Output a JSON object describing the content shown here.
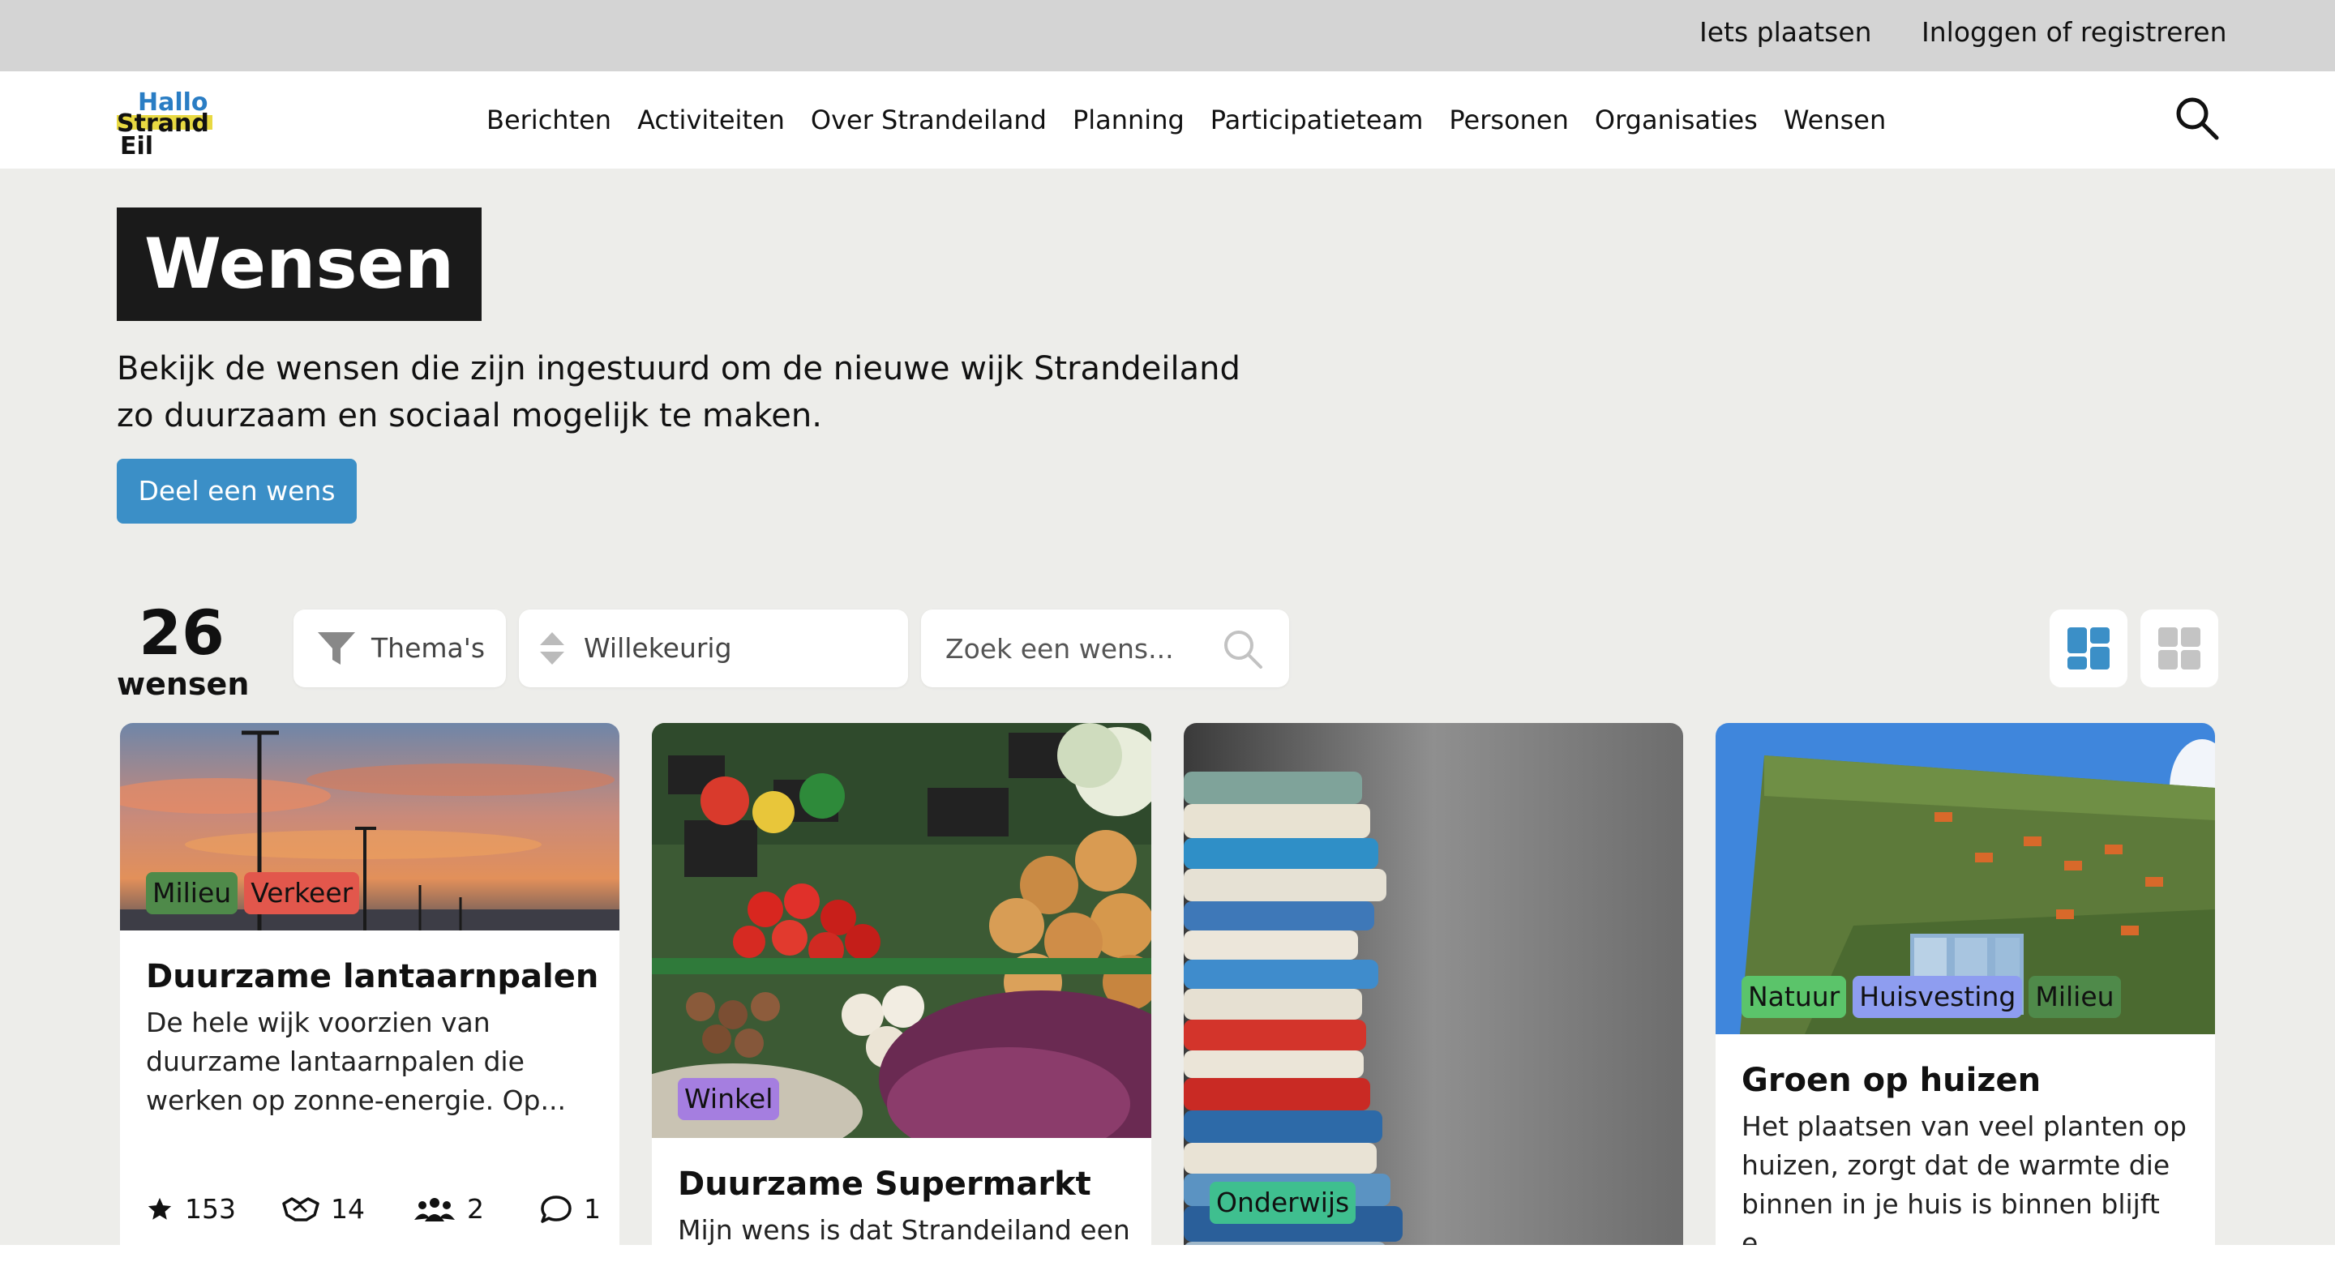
{
  "topbar": {
    "post_link": "Iets plaatsen",
    "login_link": "Inloggen of registreren"
  },
  "logo": {
    "line1": "Hallo",
    "line2": "Strand",
    "line3": "Eil"
  },
  "nav": {
    "items": [
      "Berichten",
      "Activiteiten",
      "Over Strandeiland",
      "Planning",
      "Participatieteam",
      "Personen",
      "Organisaties",
      "Wensen"
    ]
  },
  "page": {
    "title": "Wensen",
    "intro": "Bekijk de wensen die zijn ingestuurd om de nieuwe wijk Strandeiland zo duurzaam en sociaal mogelijk te maken.",
    "cta": "Deel een wens"
  },
  "toolbar": {
    "count": "26",
    "count_label": "wensen",
    "themes_label": "Thema's",
    "sort_label": "Willekeurig",
    "search_placeholder": "Zoek een wens..."
  },
  "colors": {
    "accent": "#3b8fc7",
    "tag_milieu": "#4f8a4a",
    "tag_verkeer": "#e2574c",
    "tag_winkel": "#a57ee0",
    "tag_onderwijs": "#3fbf8f",
    "tag_natuur": "#5bc46a",
    "tag_huisvesting": "#8e9df0"
  },
  "cards": [
    {
      "tags": [
        "Milieu",
        "Verkeer"
      ],
      "title": "Duurzame lantaarnpalen",
      "desc": "De hele wijk voorzien van duurzame lantaarnpalen die werken op zonne-energie. Op...",
      "stars": "153",
      "support": "14",
      "people": "2",
      "comments": "1"
    },
    {
      "tags": [
        "Winkel"
      ],
      "title": "Duurzame Supermarkt",
      "desc": "Mijn wens is dat Strandeiland een"
    },
    {
      "tags": [
        "Onderwijs"
      ]
    },
    {
      "tags": [
        "Natuur",
        "Huisvesting",
        "Milieu"
      ],
      "title": "Groen op huizen",
      "desc": "Het plaatsen van veel planten op huizen, zorgt dat de warmte die binnen in je huis is binnen blijft e..."
    }
  ]
}
